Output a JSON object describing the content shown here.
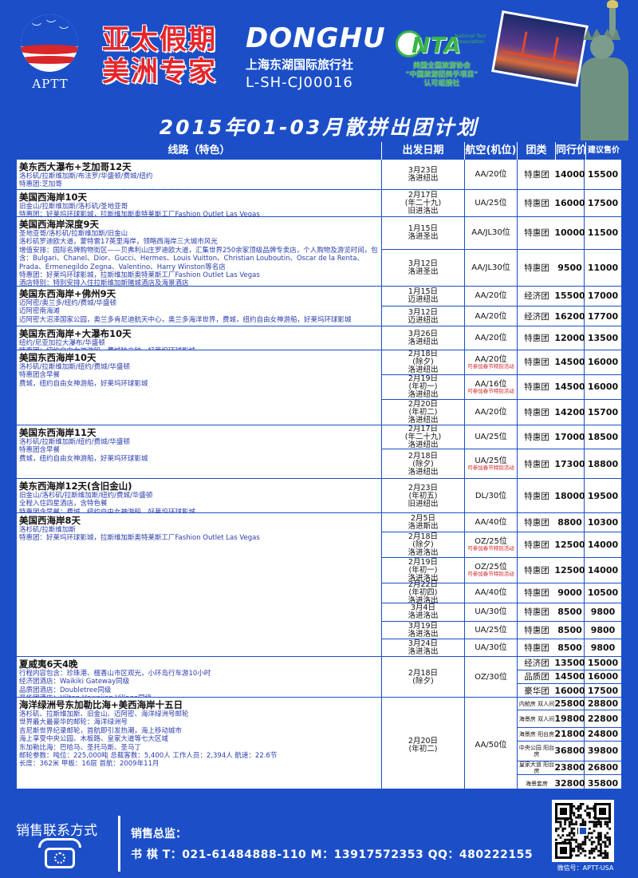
{
  "header": {
    "aptt_text": "APTT",
    "brand_line1": "亚太假期",
    "brand_line2": "美洲专家",
    "donghu_logo": "DONGHU",
    "donghu_cn": "上海东湖国际旅行社",
    "license": "L-SH-CJ00016",
    "nta_letters": "NTA",
    "nta_tag": "National Tour Association",
    "nta_line1": "美国全国旅游协会",
    "nta_line2": "\"中国旅游团美手项目\"",
    "nta_line3": "认可组接社"
  },
  "title": "2015年01-03月散拼出团计划",
  "columns": [
    "线路（特色）",
    "出发日期",
    "航空(机位)",
    "团类",
    "同行价",
    "建议售价"
  ],
  "rows": [
    {
      "name": "美东西大瀑布+芝加哥12天",
      "desc": "洛杉矶/拉斯维加斯/布法罗/华盛顿/费城/纽约\n特惠团:芝加哥\n拉斯维加斯夜景，纽约自由女神，费城独立钟，奥特莱斯工厂Fashion Outlet Las Vegas",
      "subs": [
        {
          "date": [
            "3月23日",
            "洛进纽出"
          ],
          "air": "AA/20位",
          "notes": [],
          "type": "特惠团",
          "p1": "14000",
          "p2": "15500"
        }
      ]
    },
    {
      "name": "美国西海岸10天",
      "desc": "旧金山/拉斯维加斯/洛杉矶/圣地亚哥\n特惠团：好莱坞环球影城，拉斯维加斯奥特莱斯工厂Fashion Outlet Las Vegas",
      "subs": [
        {
          "date": [
            "2月17日",
            "(年二十九)",
            "旧进洛出"
          ],
          "air": "UA/25位",
          "notes": [],
          "type": "特惠团",
          "p1": "16000",
          "p2": "17500"
        }
      ]
    },
    {
      "name": "美国西海岸深度9天",
      "desc": "圣地亚哥/洛杉矶/拉斯维加斯/旧金山\n洛杉矶罗迪欧大道，蒙特雷17英里海岸，领略西海岸三大城市风光\n增值安排：国际名牌购物街区——贝弗利山庄罗迪欧大道，汇集世界250余家顶级品牌专卖店，个人购物及游览时间，包含：Bulgari、Chanel、Dior、Gucci、Hermes、Louis Vuitton、Christian Louboutin、Oscar de la Renta、Prada、Ermenegildo Zegna、Valentino、Harry Winston等名店\n特惠团：好莱坞环球影城，拉斯维加斯奥特莱斯工厂Fashion Outlet Las Vegas\n酒店特别：特别安排入住拉斯维加斯赌城酒店及海景酒店",
      "subs": [
        {
          "date": [
            "1月15日",
            "洛进圣出"
          ],
          "air": "AA/JL30位",
          "notes": [],
          "type": "特惠团",
          "p1": "10000",
          "p2": "11500"
        },
        {
          "date": [
            "3月12日",
            "洛进圣出"
          ],
          "air": "AA/JL30位",
          "notes": [],
          "type": "特惠团",
          "p1": "9500",
          "p2": "11000"
        }
      ]
    },
    {
      "name": "美国东西海岸+佛州9天",
      "desc": "迈阿密/奥兰多/纽约/费城/华盛顿\n迈阿密南海滩\n迈阿密大沼泽国家公园，奥兰多肯尼迪航天中心，奥兰多海洋世界，费城，纽约自由女神游船，好莱坞环球影城",
      "subs": [
        {
          "date": [
            "1月15日",
            "迈进纽出"
          ],
          "air": "AA/20位",
          "notes": [],
          "type": "经济团",
          "p1": "15500",
          "p2": "17000"
        },
        {
          "date": [
            "3月12日",
            "迈进纽出"
          ],
          "air": "AA/20位",
          "notes": [],
          "type": "经济团",
          "p1": "16200",
          "p2": "17700"
        }
      ]
    },
    {
      "name": "美国东西海岸+大瀑布10天",
      "desc": "纽约/尼亚加拉大瀑布/华盛顿\n特惠团：纽约自由女神游船，费城独立钟，好莱坞环球影城",
      "subs": [
        {
          "date": [
            "3月26日",
            "洛进纽出"
          ],
          "air": "AA/20位",
          "notes": [],
          "type": "特惠团",
          "p1": "12000",
          "p2": "13500"
        }
      ]
    },
    {
      "name": "美国东西海岸10天",
      "desc": "洛杉矶/拉斯维加斯/纽约/费城/华盛顿\n特惠团含早餐\n费城，纽约自由女神游船，好莱坞环球影城",
      "subs": [
        {
          "date": [
            "2月18日",
            "(除夕)",
            "洛进纽出"
          ],
          "air": "AA/20位",
          "notes": [
            "可参加春节特别活动"
          ],
          "type": "特惠团",
          "p1": "14500",
          "p2": "16000"
        },
        {
          "date": [
            "2月19日",
            "(年初一)",
            "洛进纽出"
          ],
          "air": "AA/16位",
          "notes": [
            "可参加春节特别活动"
          ],
          "type": "特惠团",
          "p1": "14500",
          "p2": "16000"
        },
        {
          "date": [
            "2月20日",
            "(年初二)",
            "洛进纽出"
          ],
          "air": "AA/20位",
          "notes": [],
          "type": "特惠团",
          "p1": "14200",
          "p2": "15700"
        }
      ]
    },
    {
      "name": "美国东西海岸11天",
      "desc": "洛杉矶/拉斯维加斯/纽约/费城/华盛顿\n特惠团含早餐\n费城，纽约自由女神游船，好莱坞环球影城",
      "subs": [
        {
          "date": [
            "2月17日",
            "(年二十九)",
            "洛进纽出"
          ],
          "air": "UA/25位",
          "notes": [],
          "type": "特惠团",
          "p1": "17000",
          "p2": "18500"
        },
        {
          "date": [
            "2月18日",
            "(除夕)",
            "洛进纽出"
          ],
          "air": "UA/25位",
          "notes": [
            "可参加春节特别活动"
          ],
          "type": "特惠团",
          "p1": "17300",
          "p2": "18800"
        }
      ]
    },
    {
      "name": "美东西海岸12天(含旧金山)",
      "desc": "旧金山/洛杉矶/拉斯维加斯/纽约/费城/华盛顿\n全程入住四星酒店，含特色餐\n特惠团含早餐：费城，纽约自由女神游船，好莱坞环球影城",
      "subs": [
        {
          "date": [
            "2月23日",
            "(年初五)",
            "旧进纽出"
          ],
          "air": "DL/30位",
          "notes": [],
          "type": "特惠团",
          "p1": "18000",
          "p2": "19500"
        }
      ]
    },
    {
      "name": "美国西海岸8天",
      "desc": "洛杉矶/拉斯维加斯\n特惠团：好莱坞环球影城，拉斯维加斯奥特莱斯工厂Fashion Outlet Las Vegas",
      "subs": [
        {
          "date": [
            "2月5日",
            "洛进斯出"
          ],
          "air": "AA/40位",
          "notes": [],
          "type": "特惠团",
          "p1": "8800",
          "p2": "10300"
        },
        {
          "date": [
            "2月18日",
            "(除夕)",
            "洛进洛出"
          ],
          "air": "OZ/25位",
          "notes": [
            "可参加春节特别活动"
          ],
          "type": "特惠团",
          "p1": "12500",
          "p2": "14000"
        },
        {
          "date": [
            "2月19日",
            "(年初一)",
            "洛进洛出"
          ],
          "air": "OZ/25位",
          "notes": [
            "可参加春节特别活动"
          ],
          "type": "特惠团",
          "p1": "12500",
          "p2": "14000"
        },
        {
          "date": [
            "2月22日",
            "(年初四)",
            "洛进洛出"
          ],
          "air": "AA/40位",
          "notes": [],
          "type": "特惠团",
          "p1": "9000",
          "p2": "10500"
        },
        {
          "date": [
            "3月4日",
            "洛进洛出"
          ],
          "air": "UA/30位",
          "notes": [],
          "type": "特惠团",
          "p1": "8500",
          "p2": "9800"
        },
        {
          "date": [
            "3月19日",
            "洛进洛出"
          ],
          "air": "UA/25位",
          "notes": [],
          "type": "特惠团",
          "p1": "8500",
          "p2": "9800"
        },
        {
          "date": [
            "3月24日",
            "洛进洛出"
          ],
          "air": "UA/30位",
          "notes": [],
          "type": "特惠团",
          "p1": "8500",
          "p2": "9800"
        }
      ]
    },
    {
      "name": "夏威夷6天4晚",
      "desc": "行程内容包含：珍珠港、檀香山市区观光，小环岛行车游10小时\n经济团酒店：Waikiki Gateway同级\n品质团酒店：Doubletree同级\n豪华团酒店：Hilton Hawaiian Village同级",
      "subs": [
        {
          "date": [
            "2月18日",
            "(除夕)"
          ],
          "air": "OZ/30位",
          "notes": [],
          "type": "经济团",
          "p1": "13500",
          "p2": "15000",
          "multi": [
            [
              "经济团",
              "13500",
              "15000"
            ],
            [
              "品质团",
              "14500",
              "16000"
            ],
            [
              "豪华团",
              "16000",
              "17500"
            ]
          ]
        }
      ]
    },
    {
      "name": "海洋绿洲号东加勒比海+美西海岸十五日",
      "desc": "洛杉矶、拉斯维加斯、旧金山、迈阿密、海洋绿洲号邮轮\n世界最大最豪华的邮轮：海洋绿洲号\n吉尼斯世界纪录邮轮，首航即引发热潮，海上移动城市\n海上享受中央公园、木板路、皇家大道等七大区域\n东加勒比海：巴哈马、圣托马斯、圣马丁\n邮轮参数：吨位：225,000吨   总载客数：5,400人   工作人员：2,394人   航速：22.6节\n长度：362米   甲板：16层   首航：2009年11月",
      "subs": [
        {
          "date": [
            "2月20日",
            "(年初二)"
          ],
          "air": "AA/50位",
          "notes": [],
          "type": "",
          "p1": "",
          "p2": "",
          "cruise": [
            [
              "内舱房 双人间",
              "25800",
              "28800"
            ],
            [
              "海景房 双人间",
              "19800",
              "22800"
            ],
            [
              "海景房 阳台房",
              "21800",
              "24800"
            ],
            [
              "中央公园 阳台房",
              "36800",
              "39800"
            ],
            [
              "皇家大道 阳台房",
              "23800",
              "26800"
            ],
            [
              "海景套房",
              "32800",
              "35800"
            ]
          ]
        }
      ]
    }
  ],
  "footer": {
    "label": "销售联系方式",
    "sales_title": "销售总监：",
    "sales_line": "书  棋  T：021-61484888-110  M：13917572353  QQ：480222155",
    "qr_caption": "微信号：APTT-USA"
  }
}
